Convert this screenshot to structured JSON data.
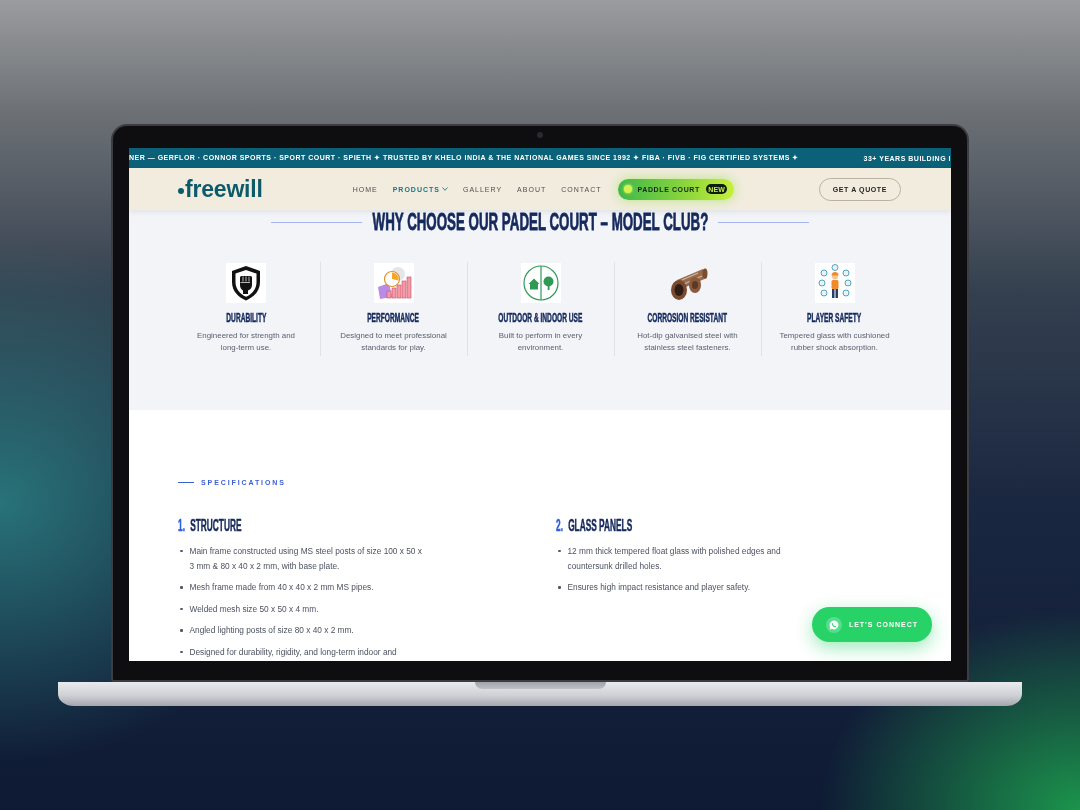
{
  "ticker": {
    "items": [
      "NER — GERFLOR · CONNOR SPORTS · SPORT COURT · SPIETH ✦ TRUSTED BY KHELO INDIA & THE NATIONAL GAMES SINCE 1992 ✦ FIBA · FIVB · FIG CERTIFIED SYSTEMS ✦",
      "33+ YEARS BUILDING I"
    ]
  },
  "nav": {
    "logo": "freewill",
    "links": [
      {
        "label": "HOME",
        "selected": false,
        "dropdown": false
      },
      {
        "label": "PRODUCTS",
        "selected": true,
        "dropdown": true
      },
      {
        "label": "GALLERY",
        "selected": false,
        "dropdown": false
      },
      {
        "label": "ABOUT",
        "selected": false,
        "dropdown": false
      },
      {
        "label": "CONTACT",
        "selected": false,
        "dropdown": false
      }
    ],
    "promo": {
      "label": "PADDLE COURT",
      "badge": "NEW"
    },
    "cta": "GET A QUOTE"
  },
  "why_choose": {
    "title": "WHY CHOOSE OUR PADEL COURT – MODEL CLUB?",
    "features": [
      {
        "kind": "shield",
        "title": "DURABILITY",
        "text": "Engineered for strength and long-term use."
      },
      {
        "kind": "chart",
        "title": "PERFORMANCE",
        "text": "Designed to meet professional standards for play."
      },
      {
        "kind": "outdoor",
        "title": "OUTDOOR & INDOOR USE",
        "text": "Built to perform in every environment."
      },
      {
        "kind": "pipe",
        "title": "CORROSION RESISTANT",
        "text": "Hot-dip galvanised steel with stainless steel fasteners."
      },
      {
        "kind": "safety",
        "title": "PLAYER SAFETY",
        "text": "Tempered glass with cushioned rubber shock absorption."
      }
    ]
  },
  "specifications": {
    "eyebrow": "SPECIFICATIONS",
    "groups": [
      {
        "number": "1.",
        "title": "STRUCTURE",
        "items": [
          "Main frame constructed using MS steel posts of size 100 x 50 x 3 mm & 80 x 40 x 2 mm, with base plate.",
          "Mesh frame made from 40 x 40 x 2 mm MS pipes.",
          "Welded mesh size 50 x 50 x 4 mm.",
          "Angled lighting posts of size 80 x 40 x 2 mm.",
          "Designed for durability, rigidity, and long-term indoor and"
        ]
      },
      {
        "number": "2.",
        "title": "GLASS PANELS",
        "items": [
          "12 mm thick tempered float glass with polished edges and countersunk drilled holes.",
          "Ensures high impact resistance and player safety."
        ]
      }
    ]
  },
  "connect_button": {
    "label": "LET'S CONNECT"
  }
}
